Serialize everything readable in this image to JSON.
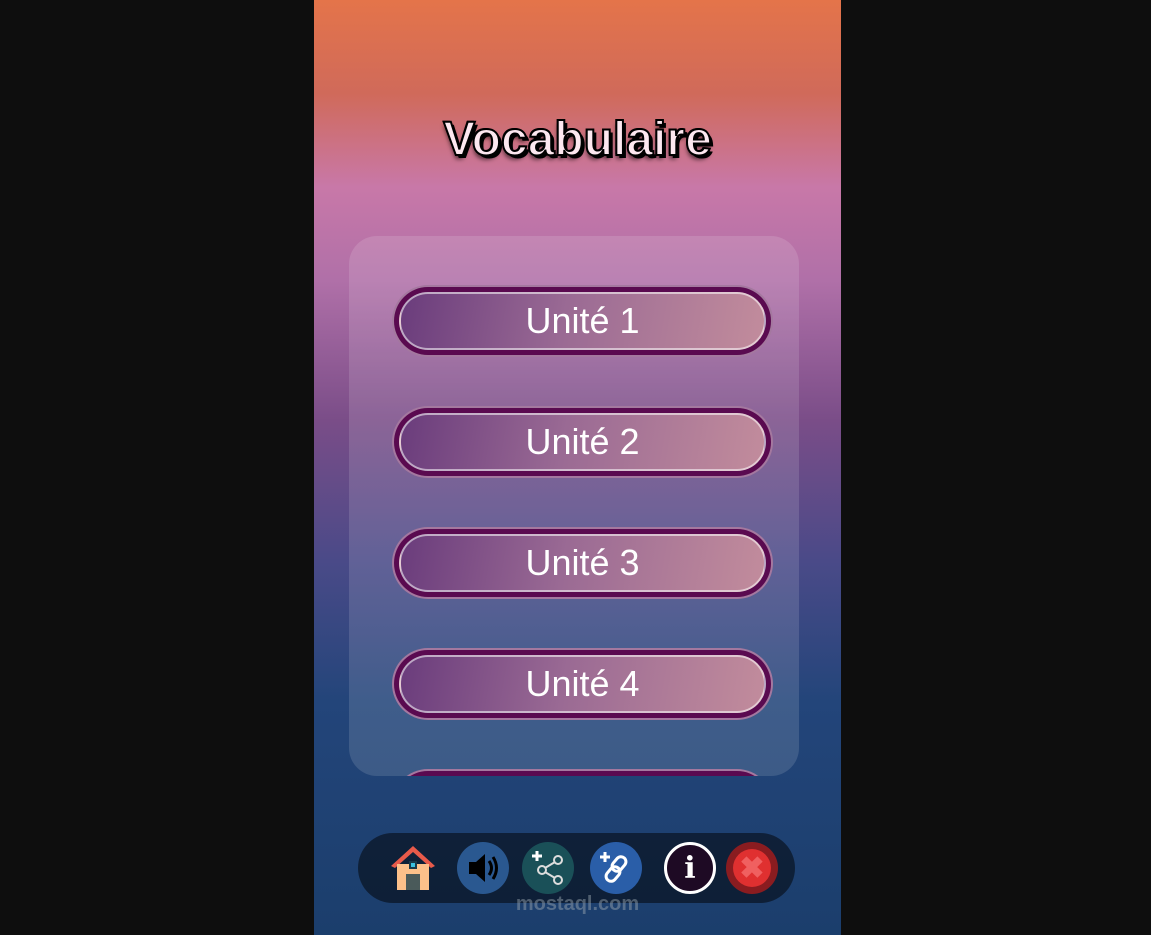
{
  "title": "Vocabulaire",
  "units": [
    {
      "label": "Unité 1"
    },
    {
      "label": "Unité 2"
    },
    {
      "label": "Unité 3"
    },
    {
      "label": "Unité 4"
    },
    {
      "label": ""
    }
  ],
  "toolbar": {
    "icons": [
      "home-icon",
      "speaker-icon",
      "share-icon",
      "link-icon",
      "info-icon",
      "close-icon"
    ],
    "info_glyph": "i"
  },
  "watermark": "mostaql.com",
  "colors": {
    "button_border": "#5a0a50",
    "toolbar_bg": "#000000",
    "close": "#e03030",
    "link": "#2a5ea8"
  }
}
